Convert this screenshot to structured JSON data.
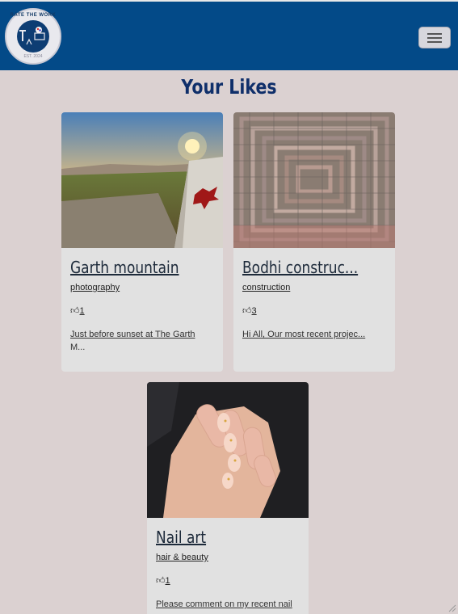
{
  "navbar": {
    "logo_text": "RATE THE WORK",
    "logo_est": "EST. 2024",
    "toggle_label": "menu-icon"
  },
  "page": {
    "title": "Your Likes"
  },
  "cards": [
    {
      "title": "Garth mountain",
      "category": "photography",
      "likes": "1",
      "desc_link": "Just before sunset at The Garth",
      "desc_rest": "M..."
    },
    {
      "title": "Bodhi construc...",
      "category": "construction",
      "likes": "3",
      "desc_link": "Hi All, Our most recent projec...",
      "desc_rest": ""
    },
    {
      "title": "Nail art",
      "category": "hair & beauty",
      "likes": "1",
      "desc_link": "Please comment on my recent nail",
      "desc_rest": ""
    }
  ],
  "colors": {
    "navbar": "#034a88",
    "background": "#dbd1d1",
    "card": "#e1e1e1",
    "title": "#0f2f6a"
  }
}
